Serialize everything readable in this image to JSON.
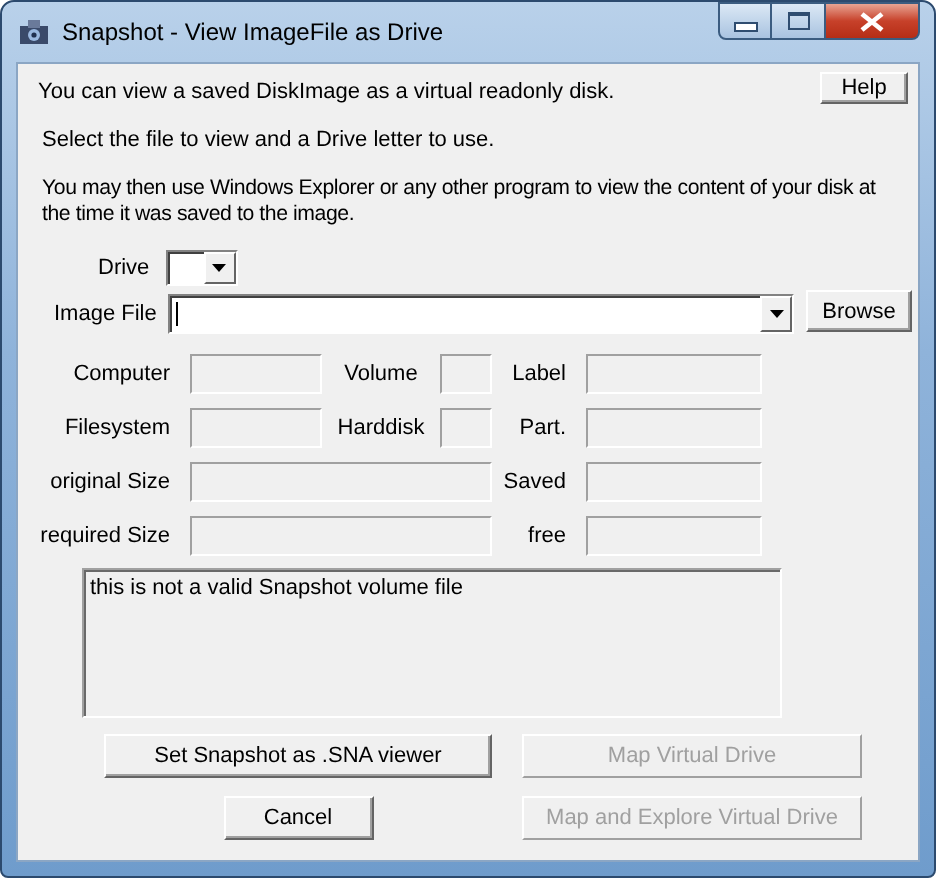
{
  "window": {
    "title": "Snapshot - View ImageFile as Drive"
  },
  "help_button": {
    "label": "Help"
  },
  "paragraphs": [
    "You can view a saved DiskImage as a virtual readonly disk.",
    "Select the file to view and a Drive letter to use.",
    "You may then use Windows Explorer or any other program to view the content of your disk at the time it was saved to the image."
  ],
  "drive": {
    "label": "Drive"
  },
  "image_file": {
    "label": "Image File",
    "browse": "Browse"
  },
  "fields": [
    {
      "label": "Computer",
      "kind": "box"
    },
    {
      "label": "Volume",
      "kind": "box"
    },
    {
      "label": "Label",
      "kind": "box"
    },
    {
      "label": "Filesystem",
      "kind": "box"
    },
    {
      "label": "Harddisk",
      "kind": "box"
    },
    {
      "label": "Part.",
      "kind": "box"
    },
    {
      "label": "original Size",
      "kind": "wide"
    },
    {
      "label": "Saved",
      "kind": "box"
    },
    {
      "label": "required Size",
      "kind": "wide"
    },
    {
      "label": "free",
      "kind": "box"
    }
  ],
  "message": "this is not a valid Snapshot volume file",
  "buttons": [
    {
      "label": "Set Snapshot as .SNA viewer",
      "disabled": false
    },
    {
      "label": "Map Virtual Drive",
      "disabled": true
    },
    {
      "label": "Cancel",
      "disabled": false
    },
    {
      "label": "Map and Explore Virtual Drive",
      "disabled": true
    }
  ]
}
